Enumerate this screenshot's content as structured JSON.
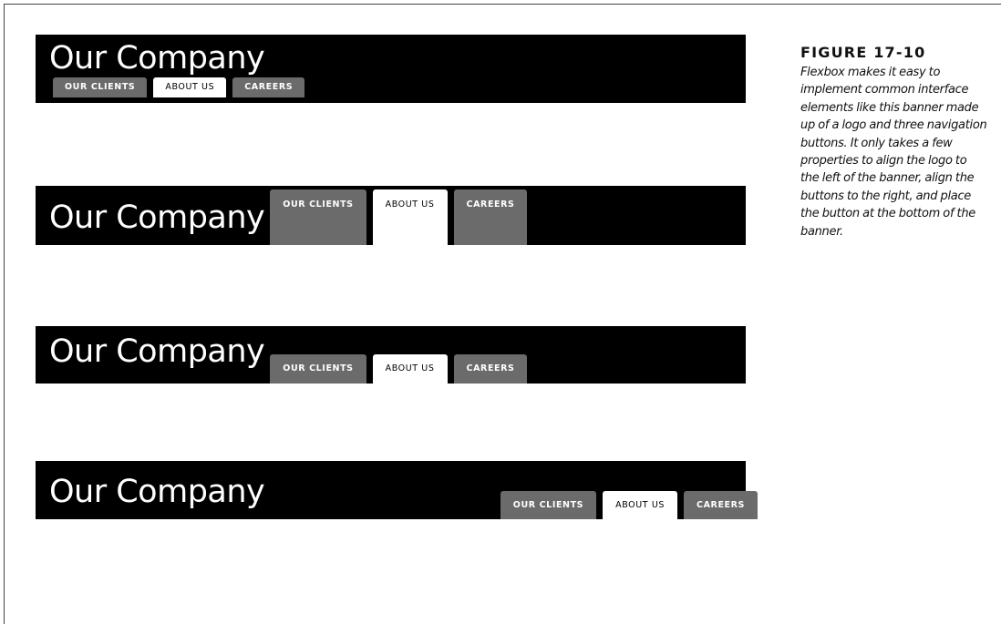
{
  "logo_text": "Our Company",
  "nav": {
    "clients": "OUR CLIENTS",
    "about": "ABOUT US",
    "careers": "CAREERS"
  },
  "caption": {
    "label": "FIGURE 17-10",
    "text": "Flexbox makes it easy to implement common interface elements like this banner made up of a logo and three navigation buttons. It only takes a few properties to align the logo to the left of the banner, align the buttons to the right, and place the button at the bottom of the banner."
  },
  "colors": {
    "banner": "#000000",
    "tab_inactive": "#6b6b6b",
    "tab_active": "#ffffff"
  }
}
